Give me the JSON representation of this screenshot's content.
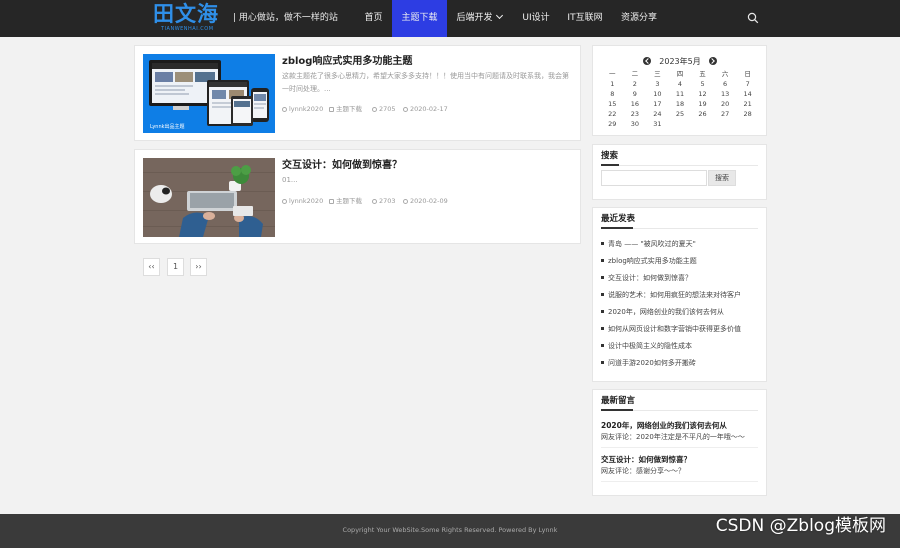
{
  "header": {
    "logo_text": "田文海",
    "logo_subtext": "TIANWENHAI.COM",
    "slogan": "| 用心做站，做不一样的站",
    "nav": [
      {
        "label": "首页",
        "active": false
      },
      {
        "label": "主题下载",
        "active": true
      },
      {
        "label": "后端开发",
        "active": false,
        "has_dropdown": true
      },
      {
        "label": "UI设计",
        "active": false
      },
      {
        "label": "IT互联网",
        "active": false
      },
      {
        "label": "资源分享",
        "active": false
      }
    ],
    "search_icon": "search-icon"
  },
  "posts": [
    {
      "title": "zblog响应式实用多功能主题",
      "excerpt": "这款主题花了很多心思精力，希望大家多多支持！！！使用当中有问题请及时联系我，我会第一时间处理。...",
      "author": "lynnk2020",
      "category": "主题下载",
      "views": "2705",
      "date": "2020-02-17",
      "thumb_caption": "Lynnk出品主题"
    },
    {
      "title": "交互设计：如何做到惊喜？",
      "excerpt": "01...",
      "author": "lynnk2020",
      "category": "主题下载",
      "views": "2703",
      "date": "2020-02-09"
    }
  ],
  "pagination": {
    "prev": "‹‹",
    "current": "1",
    "next": "››"
  },
  "calendar": {
    "title": "2023年5月",
    "weekdays": [
      "一",
      "二",
      "三",
      "四",
      "五",
      "六",
      "日"
    ],
    "rows": [
      [
        "1",
        "2",
        "3",
        "4",
        "5",
        "6",
        "7"
      ],
      [
        "8",
        "9",
        "10",
        "11",
        "12",
        "13",
        "14"
      ],
      [
        "15",
        "16",
        "17",
        "18",
        "19",
        "20",
        "21"
      ],
      [
        "22",
        "23",
        "24",
        "25",
        "26",
        "27",
        "28"
      ],
      [
        "29",
        "30",
        "31",
        "",
        "",
        "",
        ""
      ]
    ]
  },
  "search_widget": {
    "title": "搜索",
    "button_label": "搜索",
    "value": ""
  },
  "recent_widget": {
    "title": "最近发表",
    "items": [
      "青岛 —— \"被风吹过的夏天\"",
      "zblog响应式实用多功能主题",
      "交互设计：如何做到惊喜？",
      "说服的艺术：如何用疯狂的想法来对待客户",
      "2020年，网络创业的我们该何去何从",
      "如何从网页设计和数字营销中获得更多价值",
      "设计中极简主义的隐性成本",
      "问道手游2020如何多开搬砖"
    ]
  },
  "comments_widget": {
    "title": "最新留言",
    "items": [
      {
        "title": "2020年，网络创业的我们该何去何从",
        "text": "网友评论：2020年注定是不平凡的一年哦～～"
      },
      {
        "title": "交互设计：如何做到惊喜？",
        "text": "网友评论：感谢分享～～？"
      }
    ]
  },
  "footer": {
    "text": "Copyright Your WebSite.Some Rights Reserved. Powered By Lynnk"
  },
  "watermark": "CSDN @Zblog模板网",
  "colors": {
    "header_bg": "#262626",
    "nav_active": "#2d3de3",
    "logo": "#2f8fe8",
    "footer_bg": "#3a3a3a"
  }
}
